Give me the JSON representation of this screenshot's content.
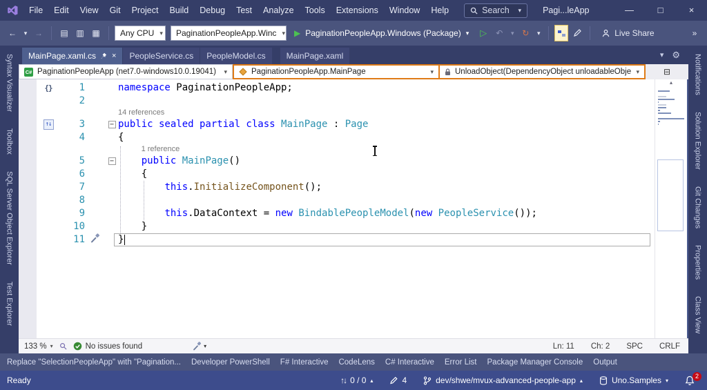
{
  "title_bar": {
    "window_title": "Pagi...leApp",
    "search_label": "Search",
    "menus": [
      "File",
      "Edit",
      "View",
      "Git",
      "Project",
      "Build",
      "Debug",
      "Test",
      "Analyze",
      "Tools",
      "Extensions",
      "Window",
      "Help"
    ]
  },
  "icons": {
    "dropdown": "▾",
    "dropdown_up": "▴",
    "back": "←",
    "forward": "→",
    "play": "▶",
    "play_outline": "▷",
    "undo": "↶",
    "refresh": "↻",
    "minimize": "—",
    "maximize": "□",
    "close": "×",
    "gear": "⚙",
    "split_editor": "⊟",
    "overflow": "»",
    "new_file": "▤",
    "add_item": "▥",
    "save_all": "▦",
    "fold_collapse": "−",
    "braces": "{}",
    "inherit_arrows": "↑↓",
    "sync_arrows": "↑↓",
    "minimap_up": "▴"
  },
  "toolbar": {
    "platform_combo": "Any CPU",
    "startup_combo": "PaginationPeopleApp.Winc",
    "run_target": "PaginationPeopleApp.Windows (Package)",
    "live_share_label": "Live Share"
  },
  "document_tabs": [
    {
      "label": "MainPage.xaml.cs",
      "active": true
    },
    {
      "label": "PeopleService.cs"
    },
    {
      "label": "PeopleModel.cs"
    },
    {
      "label": "MainPage.xaml",
      "gap_before": true
    }
  ],
  "nav_bar": {
    "project": "PaginationPeopleApp (net7.0-windows10.0.19041)",
    "type": "PaginationPeopleApp.MainPage",
    "member": "UnloadObject(DependencyObject unloadableObje"
  },
  "left_rail": [
    "Syntax Visualizer",
    "Toolbox",
    "SQL Server Object Explorer",
    "Test Explorer"
  ],
  "right_rail": [
    "Notifications",
    "Solution Explorer",
    "Git Changes",
    "Properties",
    "Class View"
  ],
  "editor": {
    "zoom": "133 %",
    "health": "No issues found",
    "line_info": "Ln: 11",
    "col_info": "Ch: 2",
    "space_mode": "SPC",
    "eol_mode": "CRLF",
    "lines": [
      {
        "num": "1",
        "margin_icon": "braces",
        "tokens": [
          {
            "t": "namespace",
            "c": "kw"
          },
          {
            "t": " PaginationPeopleApp;",
            "c": "pl"
          }
        ]
      },
      {
        "num": "2",
        "tokens": []
      },
      {
        "lens": "14 references",
        "indent": 0
      },
      {
        "num": "3",
        "fold": true,
        "margin_icon": "inherit",
        "tokens": [
          {
            "t": "public sealed partial class ",
            "c": "kw"
          },
          {
            "t": "MainPage",
            "c": "ty"
          },
          {
            "t": " : ",
            "c": "pl"
          },
          {
            "t": "Page",
            "c": "ty"
          }
        ]
      },
      {
        "num": "4",
        "tokens": [
          {
            "t": "{",
            "c": "pl"
          }
        ]
      },
      {
        "lens": "1 reference",
        "indent": 4
      },
      {
        "num": "5",
        "fold": true,
        "tokens": [
          {
            "t": "    ",
            "c": "pl"
          },
          {
            "t": "public",
            "c": "kw"
          },
          {
            "t": " ",
            "c": "pl"
          },
          {
            "t": "MainPage",
            "c": "ty"
          },
          {
            "t": "()",
            "c": "pl"
          }
        ]
      },
      {
        "num": "6",
        "tokens": [
          {
            "t": "    {",
            "c": "pl"
          }
        ]
      },
      {
        "num": "7",
        "tokens": [
          {
            "t": "        ",
            "c": "pl"
          },
          {
            "t": "this",
            "c": "kw"
          },
          {
            "t": ".",
            "c": "pl"
          },
          {
            "t": "InitializeComponent",
            "c": "me"
          },
          {
            "t": "();",
            "c": "pl"
          }
        ]
      },
      {
        "num": "8",
        "tokens": []
      },
      {
        "num": "9",
        "tokens": [
          {
            "t": "        ",
            "c": "pl"
          },
          {
            "t": "this",
            "c": "kw"
          },
          {
            "t": ".DataContext = ",
            "c": "pl"
          },
          {
            "t": "new",
            "c": "kw"
          },
          {
            "t": " ",
            "c": "pl"
          },
          {
            "t": "BindablePeopleModel",
            "c": "ty"
          },
          {
            "t": "(",
            "c": "pl"
          },
          {
            "t": "new",
            "c": "kw"
          },
          {
            "t": " ",
            "c": "pl"
          },
          {
            "t": "PeopleService",
            "c": "ty"
          },
          {
            "t": "());",
            "c": "pl"
          }
        ]
      },
      {
        "num": "10",
        "tokens": [
          {
            "t": "    }",
            "c": "pl"
          }
        ]
      },
      {
        "num": "11",
        "current": true,
        "cursor": true,
        "margin_icon": "quickfix",
        "tokens": [
          {
            "t": "}",
            "c": "pl"
          }
        ]
      }
    ]
  },
  "bottom_tabs": [
    "Replace \"SelectionPeopleApp\" with \"Pagination...",
    "Developer PowerShell",
    "F# Interactive",
    "CodeLens",
    "C# Interactive",
    "Error List",
    "Package Manager Console",
    "Output"
  ],
  "status_bar": {
    "ready": "Ready",
    "sync_count": "0 / 0",
    "pending_edits": "4",
    "branch": "dev/shwe/mvux-advanced-people-app",
    "repo": "Uno.Samples",
    "notification_count": "2"
  },
  "colors": {
    "chrome": "#353E68",
    "toolbar": "#4A547D",
    "status_bar": "#3D4C8C",
    "accent_orange": "#DF7B16",
    "keyword": "#0000FF",
    "type_name": "#2B91AF",
    "method_name": "#74531C",
    "line_number": "#2B91AF",
    "codelens": "#7A7A7A",
    "run_green": "#4CC152",
    "badge_red": "#C50B17"
  }
}
